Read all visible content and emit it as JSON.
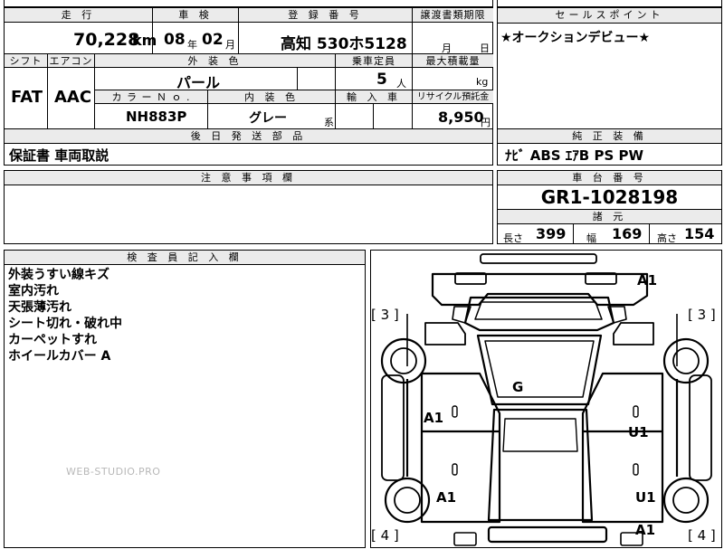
{
  "header": {
    "mileage_label": "走 行",
    "inspection_label": "車 検",
    "registration_label": "登 録 番 号",
    "transfer_label": "譲渡書類期限",
    "sales_point_label": "セールスポイント"
  },
  "vehicle": {
    "mileage": "70,228",
    "mileage_unit": "km",
    "inspection_year": "08",
    "year_unit": "年",
    "inspection_month": "02",
    "month_unit": "月",
    "registration": "高知 530ホ5128",
    "transfer_month_unit": "月",
    "transfer_day_unit": "日",
    "sales_point": "★オークションデビュー★"
  },
  "specs": {
    "shift_label": "シフト",
    "aircon_label": "エアコン",
    "exterior_color_label": "外 装 色",
    "capacity_label": "乗車定員",
    "max_load_label": "最大積載量",
    "shift": "FAT",
    "aircon": "AAC",
    "exterior_color": "パール",
    "capacity": "5",
    "capacity_unit": "人",
    "max_load_unit": "kg",
    "color_no_label": "カ ラ ー Ｎ ｏ .",
    "interior_color_label": "内 装 色",
    "import_label": "輸 入 車",
    "recycle_label": "リサイクル預託金",
    "color_no": "NH883P",
    "interior_color": "グレー",
    "interior_suffix": "系",
    "recycle_fee": "8,950",
    "recycle_unit": "円"
  },
  "followup": {
    "label": "後 日 発 送 部 品",
    "value": "保証書 車両取説"
  },
  "equipment": {
    "label": "純 正 装 備",
    "value": "ﾅﾋﾞ ABS ｴｱB PS PW"
  },
  "notes": {
    "label": "注 意 事 項 欄"
  },
  "chassis": {
    "label": "車 台 番 号",
    "value": "GR1-1028198",
    "dims_label": "諸 元",
    "length_label": "長さ",
    "length": "399",
    "width_label": "幅",
    "width": "169",
    "height_label": "高さ",
    "height": "154"
  },
  "inspector": {
    "label": "検 査 員 記 入 欄",
    "notes": [
      "外装うすい線キズ",
      "室内汚れ",
      "天張薄汚れ",
      "シート切れ・破れ中",
      "カーペットすれ",
      "ホイールカバー A"
    ]
  },
  "diagram": {
    "marks": {
      "front_bumper": "A1",
      "windshield": "G",
      "left_front_door": "A1",
      "right_front_door": "U1",
      "left_rear_wheel": "A1",
      "right_rear_wheel": "U1",
      "rear_bumper": "A1",
      "tire_lf": "[ 3 ]",
      "tire_rf": "[ 3 ]",
      "tire_lr": "[ 4 ]",
      "tire_rr": "[ 4 ]"
    }
  },
  "watermark": "WEB-STUDIO.PRO"
}
